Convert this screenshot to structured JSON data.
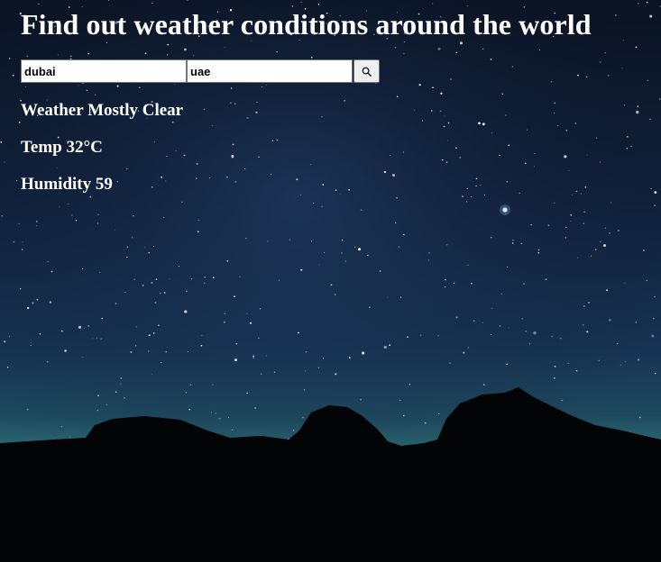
{
  "page": {
    "title": "Find out weather conditions around the world"
  },
  "search": {
    "city_value": "dubai",
    "country_value": "uae"
  },
  "weather": {
    "condition_label": "Weather",
    "condition_value": "Mostly Clear",
    "temp_label": "Temp",
    "temp_value": "32°C",
    "humidity_label": "Humidity",
    "humidity_value": "59"
  },
  "icons": {
    "search": "search-icon"
  },
  "colors": {
    "text": "#ffffff",
    "sky_top": "#0b1424",
    "sky_mid": "#152a4a",
    "horizon_glow": "#2e6a78",
    "mountains": "#030405"
  }
}
